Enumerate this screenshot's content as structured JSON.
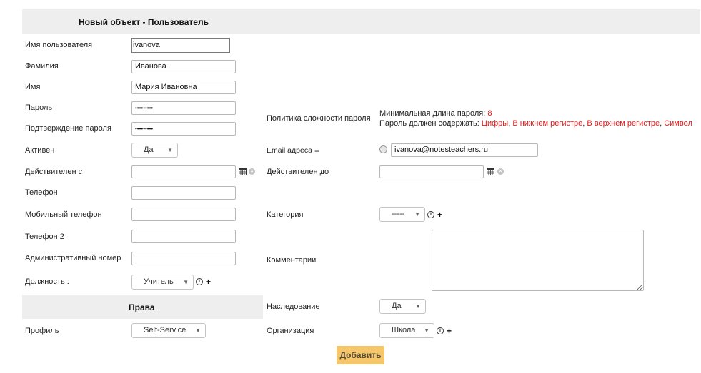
{
  "header": {
    "title": "Новый объект - Пользователь"
  },
  "left": {
    "username": {
      "label": "Имя пользователя",
      "value": "ivanova"
    },
    "lastname": {
      "label": "Фамилия",
      "value": "Иванова"
    },
    "firstname": {
      "label": "Имя",
      "value": "Мария Ивановна"
    },
    "password": {
      "label": "Пароль",
      "value": "•••••••••"
    },
    "password_confirm": {
      "label": "Подтверждение пароля",
      "value": "•••••••••"
    },
    "active": {
      "label": "Активен",
      "value": "Да"
    },
    "valid_from": {
      "label": "Действителен с",
      "value": ""
    },
    "phone": {
      "label": "Телефон",
      "value": ""
    },
    "mobile": {
      "label": "Мобильный телефон",
      "value": ""
    },
    "phone2": {
      "label": "Телефон 2",
      "value": ""
    },
    "admin_number": {
      "label": "Административный номер",
      "value": ""
    },
    "position": {
      "label": "Должность :",
      "value": "Учитель"
    }
  },
  "rights": {
    "title": "Права",
    "profile": {
      "label": "Профиль",
      "value": "Self-Service"
    }
  },
  "right": {
    "password_policy": {
      "label": "Политика сложности пароля",
      "min_length_label": "Минимальная длина пароля:",
      "min_length_value": "8",
      "must_contain_label": "Пароль должен содержать:",
      "req1": "Цифры",
      "req2": "В нижнем регистре",
      "req3": "В верхнем регистре",
      "req4": "Символ",
      "sep": ","
    },
    "email": {
      "label": "Email адреса",
      "value": "ivanova@notesteachers.ru"
    },
    "valid_to": {
      "label": "Действителен до",
      "value": ""
    },
    "category": {
      "label": "Категория",
      "value": "-----"
    },
    "comments": {
      "label": "Комментарии",
      "value": ""
    },
    "inheritance": {
      "label": "Наследование",
      "value": "Да"
    },
    "organization": {
      "label": "Организация",
      "value": "Школа"
    }
  },
  "actions": {
    "add_label": "Добавить"
  },
  "icons": {
    "calendar": "calendar-icon",
    "clear": "clear-icon",
    "info": "info-icon",
    "plus": "plus-icon",
    "dropdown": "chevron-down-icon"
  },
  "colors": {
    "accent_button": "#f5c76a",
    "required_red": "#e01b1b",
    "bar_gray": "#eeeeee"
  }
}
